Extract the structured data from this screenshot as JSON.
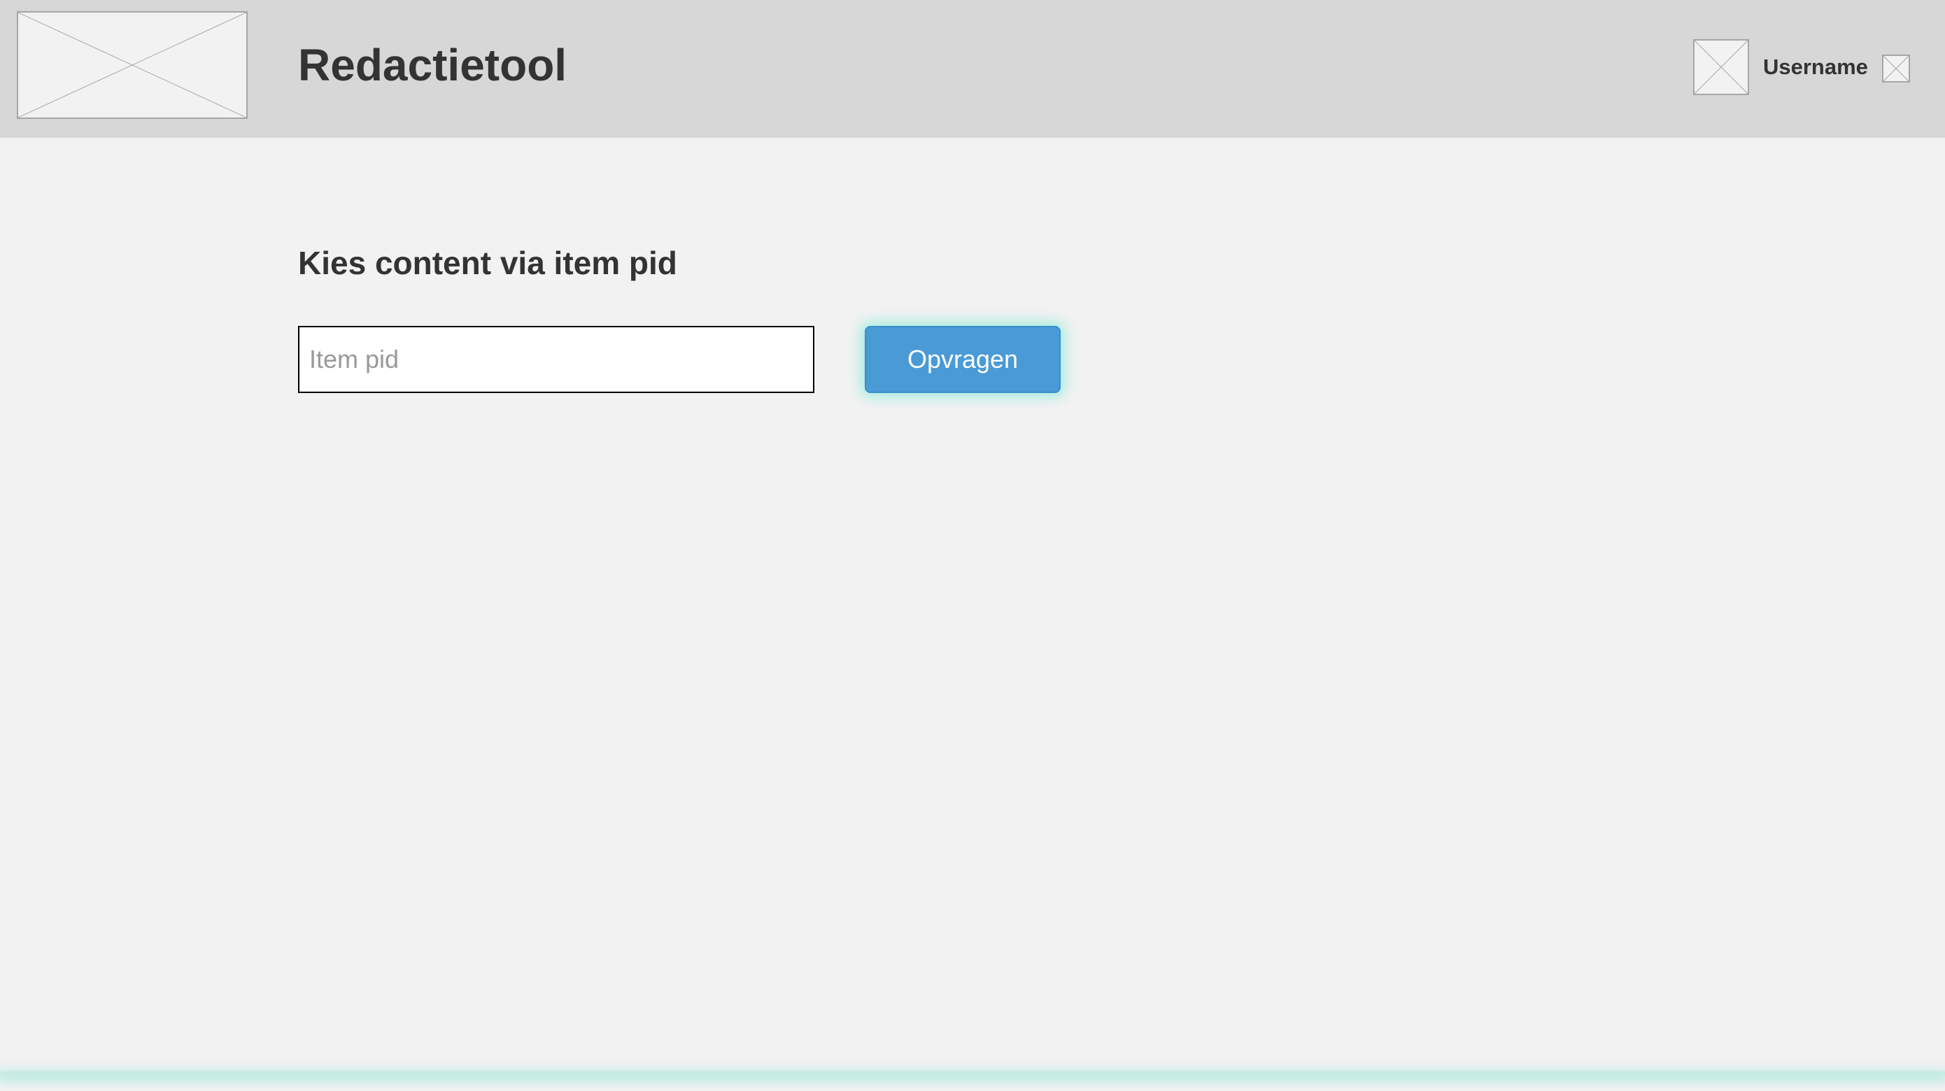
{
  "header": {
    "title": "Redactietool",
    "username": "Username",
    "logo_icon": "image-placeholder-icon",
    "avatar_icon": "image-placeholder-icon",
    "menu_icon": "image-placeholder-icon"
  },
  "main": {
    "heading": "Kies content via item pid",
    "search": {
      "value": "",
      "placeholder": "Item pid"
    },
    "submit_label": "Opvragen"
  },
  "colors": {
    "header_bg": "#d7d7d7",
    "page_bg": "#f2f2f2",
    "button_bg": "#4a9ad6",
    "button_text": "#ffffff",
    "focus_glow": "#46e6c8",
    "text": "#333333"
  }
}
